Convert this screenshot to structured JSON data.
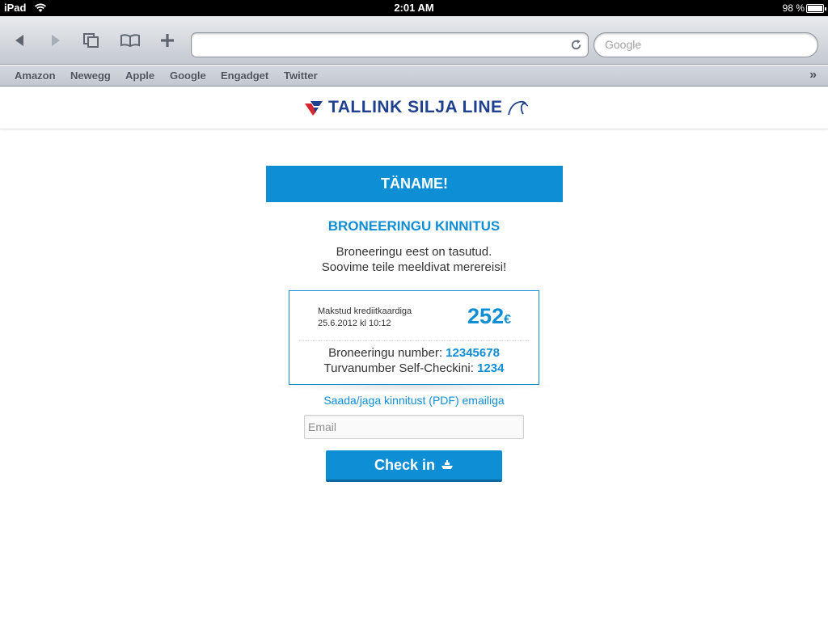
{
  "status_bar": {
    "device": "iPad",
    "time": "2:01 AM",
    "battery": "98 %",
    "battery_level": 0.98
  },
  "browser": {
    "url_value": "",
    "search_placeholder": "Google",
    "bookmarks": [
      "Amazon",
      "Newegg",
      "Apple",
      "Google",
      "Engadget",
      "Twitter"
    ],
    "more_glyph": "»"
  },
  "site": {
    "brand": "TALLINK SILJA LINE",
    "brand_color": "#1f3f8f",
    "accent_color": "#0e8ed5"
  },
  "confirmation": {
    "banner": "TÄNAME!",
    "title": "BRONEERINGU KINNITUS",
    "message_line1": "Broneeringu eest on tasutud.",
    "message_line2": "Soovime teile meeldivat merereisi!",
    "payment_method": "Makstud krediitkaardiga",
    "payment_date": "25.6.2012 kl 10:12",
    "amount": "252",
    "currency": "€",
    "booking_label": "Broneeringu number:",
    "booking_number": "12345678",
    "security_label": "Turvanumber Self-Checkini:",
    "security_number": "1234",
    "share_link": "Saada/jaga kinnitust (PDF) emailiga",
    "email_placeholder": "Email",
    "checkin_label": "Check in"
  }
}
